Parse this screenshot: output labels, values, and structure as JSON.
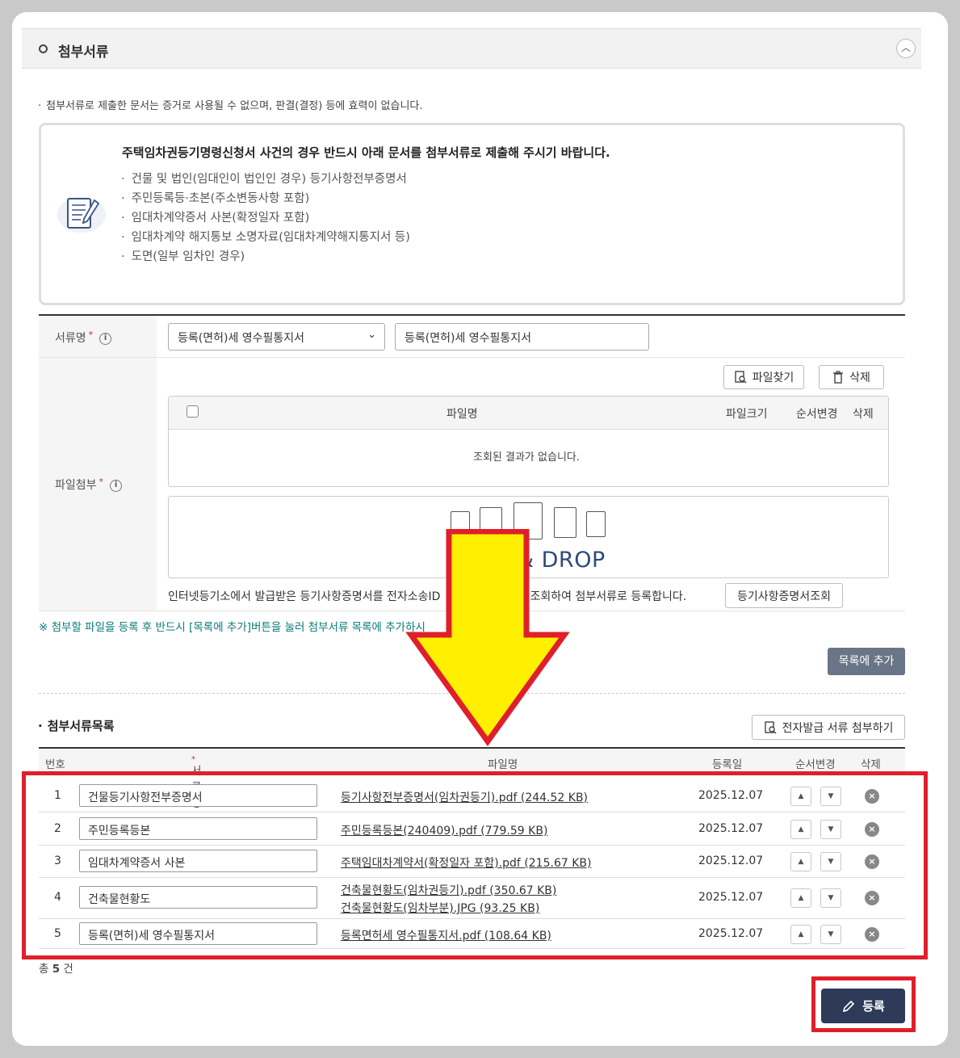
{
  "section": {
    "title": "첨부서류",
    "collapse_icon": "chevron-up-icon"
  },
  "notice": "첨부서류로 제출한 문서는 증거로 사용될 수 없으며, 판결(결정) 등에 효력이 없습니다.",
  "info": {
    "title": "주택임차권등기명령신청서 사건의 경우 반드시 아래 문서를 첨부서류로 제출해 주시기 바랍니다.",
    "items": [
      "건물 및 법인(임대인이 법인인 경우) 등기사항전부증명서",
      "주민등록등·초본(주소변동사항 포함)",
      "임대차계약증서 사본(확정일자 포함)",
      "임대차계약 해지통보 소명자료(임대차계약해지통지서 등)",
      "도면(일부 임차인 경우)"
    ]
  },
  "form": {
    "doc_label": "서류명",
    "required_mark": "*",
    "help_mark": "i",
    "doc_select_value": "등록(면허)세 영수필통지서",
    "doc_input_value": "등록(면허)세 영수필통지서",
    "file_label": "파일첨부",
    "find_button": "파일찾기",
    "delete_button": "삭제",
    "table_headers": {
      "filename": "파일명",
      "size": "파일크기",
      "order": "순서변경",
      "delete": "삭제"
    },
    "empty_text": "조회된 결과가 없습니다.",
    "drop_text": "& DROP",
    "cert_text_a": "인터넷등기소에서 발급받은 등기사항증명서를 전자소송ID",
    "cert_text_b": "호로 조회하여 첨부서류로 등록합니다.",
    "cert_button": "등기사항증명서조회",
    "note": "※ 첨부할 파일을 등록 후 반드시 [목록에 추가]버튼을 눌러 첨부서류 목록에 추가하시",
    "add_button": "목록에 추가"
  },
  "list": {
    "title": "첨부서류목록",
    "e_button": "전자발급 서류 첨부하기",
    "headers": {
      "no": "번호",
      "doc": "서류명",
      "file": "파일명",
      "date": "등록일",
      "order": "순서변경",
      "delete": "삭제"
    },
    "rows": [
      {
        "no": "1",
        "doc": "건물등기사항전부증명서",
        "files": [
          {
            "name": "등기사항전부증명서(임차권등기).pdf",
            "size": "(244.52 KB)"
          }
        ],
        "date": "2025.12.07"
      },
      {
        "no": "2",
        "doc": "주민등록등본",
        "files": [
          {
            "name": "주민등록등본(240409).pdf",
            "size": "(779.59 KB)"
          }
        ],
        "date": "2025.12.07"
      },
      {
        "no": "3",
        "doc": "임대차계약증서 사본",
        "files": [
          {
            "name": "주택임대차계약서(확정일자 포함).pdf",
            "size": "(215.67 KB)"
          }
        ],
        "date": "2025.12.07"
      },
      {
        "no": "4",
        "doc": "건축물현황도",
        "files": [
          {
            "name": "건축물현황도(임차권등기).pdf",
            "size": "(350.67 KB)"
          },
          {
            "name": "건축물현황도(임차부분).JPG",
            "size": "(93.25 KB)"
          }
        ],
        "date": "2025.12.07"
      },
      {
        "no": "5",
        "doc": "등록(면허)세 영수필통지서",
        "files": [
          {
            "name": "등록면허세 영수필통지서.pdf",
            "size": "(108.64 KB)"
          }
        ],
        "date": "2025.12.07"
      }
    ],
    "total_prefix": "총",
    "total_count": "5",
    "total_suffix": "건"
  },
  "register_button": "등록",
  "colors": {
    "highlight": "#e01f2a",
    "arrow": "#ffef00",
    "primary": "#2d3a58",
    "secondary": "#6a7587"
  }
}
